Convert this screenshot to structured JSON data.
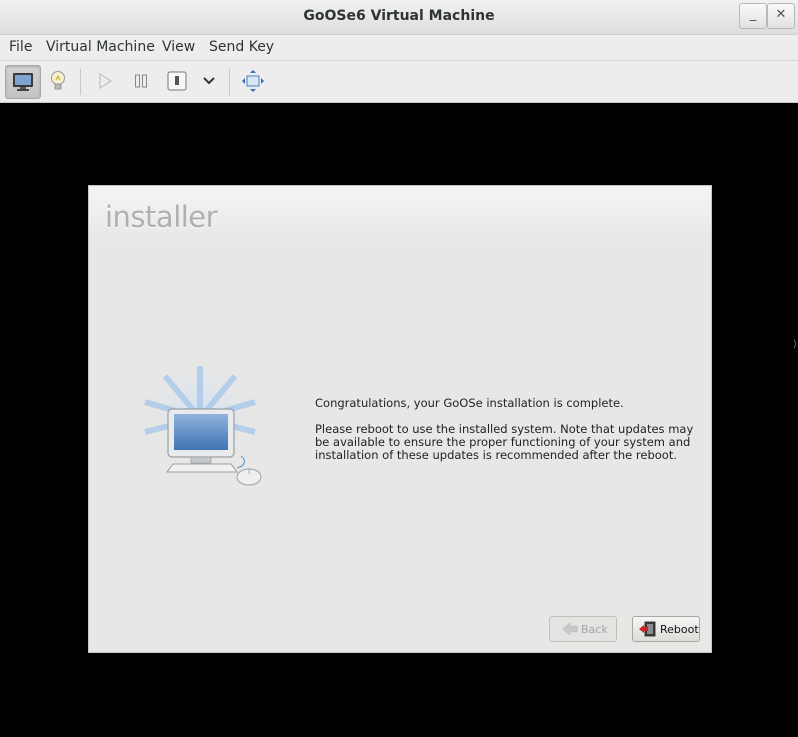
{
  "window": {
    "title": "GoOSe6 Virtual Machine",
    "minimize_glyph": "_",
    "close_glyph": "✕"
  },
  "menubar": {
    "items": [
      "File",
      "Virtual Machine",
      "View",
      "Send Key"
    ]
  },
  "toolbar": {
    "buttons": [
      {
        "icon": "monitor-icon",
        "active": true
      },
      {
        "icon": "lightbulb-icon",
        "active": false
      },
      {
        "icon": "play-icon",
        "active": false
      },
      {
        "icon": "pause-icon",
        "active": false
      },
      {
        "icon": "power-icon",
        "active": false
      },
      {
        "icon": "chevron-down-icon",
        "active": false
      },
      {
        "icon": "fullscreen-icon",
        "active": false
      }
    ]
  },
  "installer": {
    "logo": "installer",
    "message_title": "Congratulations, your GoOSe installation is complete.",
    "message_body": "Please reboot to use the installed system.  Note that updates may be available to ensure the proper functioning of your system and installation of these updates is recommended after the reboot.",
    "back_label": "Back",
    "reboot_label": "Reboot",
    "back_enabled": false
  },
  "colors": {
    "installer_bg": "#e8e7e5",
    "screen_bg": "#000000",
    "accent_blue": "#4a7fc0"
  }
}
